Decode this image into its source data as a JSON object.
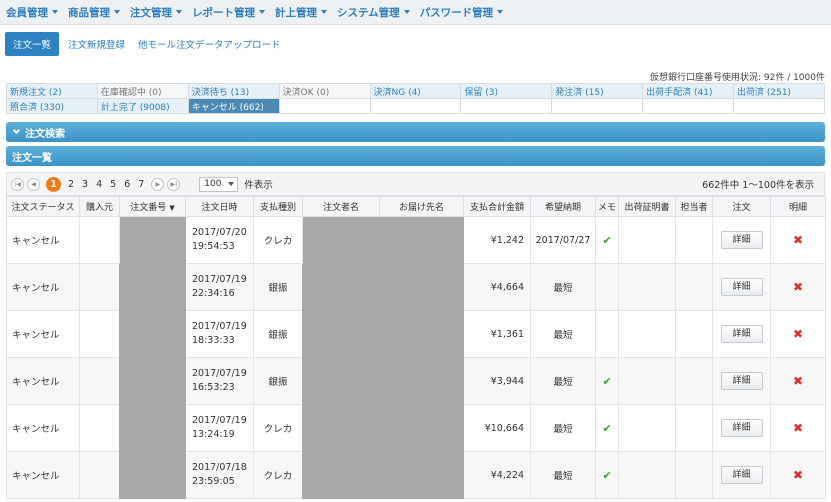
{
  "top_nav": [
    {
      "label": "会員管理"
    },
    {
      "label": "商品管理"
    },
    {
      "label": "注文管理"
    },
    {
      "label": "レポート管理"
    },
    {
      "label": "計上管理"
    },
    {
      "label": "システム管理"
    },
    {
      "label": "パスワード管理"
    }
  ],
  "sub_nav": [
    {
      "label": "注文一覧",
      "active": true
    },
    {
      "label": "注文新規登録"
    },
    {
      "label": "他モール注文データアップロード"
    }
  ],
  "account_usage": "仮想銀行口座番号使用状況: 92件 / 1000件",
  "status_rows": [
    [
      "新規注文 (2)",
      "在庫確認中 (0)",
      "決済待ち (13)",
      "決済OK (0)",
      "決済NG (4)",
      "保留 (3)",
      "発注済 (15)",
      "出荷手配済 (41)",
      "出荷済 (251)"
    ],
    [
      "照合済 (330)",
      "計上完了 (9008)",
      "キャンセル (662)",
      "",
      "",
      "",
      "",
      "",
      ""
    ]
  ],
  "search_section_title": "注文検索",
  "list_section_title": "注文一覧",
  "pagination": {
    "pages": [
      "1",
      "2",
      "3",
      "4",
      "5",
      "6",
      "7"
    ],
    "current_page": "1",
    "per_page": "100",
    "per_page_suffix": "件表示",
    "range_text": "662件中 1～100件を表示"
  },
  "table": {
    "headers": [
      "注文ステータス",
      "購入元",
      "注文番号",
      "注文日時",
      "支払種別",
      "注文者名",
      "お届け先名",
      "支払合計金額",
      "希望納期",
      "メモ",
      "出荷証明書",
      "担当者",
      "注文",
      "明細"
    ],
    "sort_marker": "▼",
    "detail_label": "詳細",
    "check_glyph": "✔",
    "delete_glyph": "✖",
    "rows": [
      {
        "status": "キャンセル",
        "date": "2017/07/20",
        "time": "19:54:53",
        "payment": "クレカ",
        "amount": "¥1,242",
        "delivery": "2017/07/27",
        "memo": true
      },
      {
        "status": "キャンセル",
        "date": "2017/07/19",
        "time": "22:34:16",
        "payment": "銀振",
        "amount": "¥4,664",
        "delivery": "最短",
        "memo": false
      },
      {
        "status": "キャンセル",
        "date": "2017/07/19",
        "time": "18:33:33",
        "payment": "銀振",
        "amount": "¥1,361",
        "delivery": "最短",
        "memo": false
      },
      {
        "status": "キャンセル",
        "date": "2017/07/19",
        "time": "16:53:23",
        "payment": "銀振",
        "amount": "¥3,944",
        "delivery": "最短",
        "memo": true
      },
      {
        "status": "キャンセル",
        "date": "2017/07/19",
        "time": "13:24:19",
        "payment": "クレカ",
        "amount": "¥10,664",
        "delivery": "最短",
        "memo": true
      },
      {
        "status": "キャンセル",
        "date": "2017/07/18",
        "time": "23:59:05",
        "payment": "クレカ",
        "amount": "¥4,224",
        "delivery": "最短",
        "memo": true
      }
    ]
  },
  "colors": {
    "accent": "#2f7fc0",
    "header_bar": "#3b93c6",
    "current_page": "#f07a18",
    "check": "#39a92d",
    "delete": "#d8322c",
    "redaction": "#a9a9a9"
  }
}
